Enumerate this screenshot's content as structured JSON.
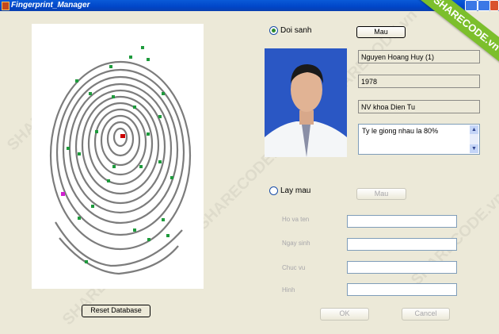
{
  "window": {
    "title": "Fingerprint_Manager"
  },
  "watermark": "SHARECODE.vn",
  "ribbon": "SHARECODE.vn",
  "compare": {
    "radio_label": "Doi sanh",
    "mau_button": "Mau",
    "name": "Nguyen Hoang Huy (1)",
    "year": "1978",
    "position": "NV khoa Dien Tu",
    "similarity": "Ty le giong nhau la 80%"
  },
  "sample": {
    "radio_label": "Lay mau",
    "mau_button": "Mau",
    "labels": {
      "name": "Ho va ten",
      "dob": "Ngay sinh",
      "position": "Chuc vu",
      "image": "Hinh"
    },
    "ok_button": "OK",
    "cancel_button": "Cancel"
  },
  "reset_button": "Reset Database",
  "colors": {
    "minutia": "#1e9a3c",
    "core": "#cc0000",
    "delta": "#d020d0"
  }
}
